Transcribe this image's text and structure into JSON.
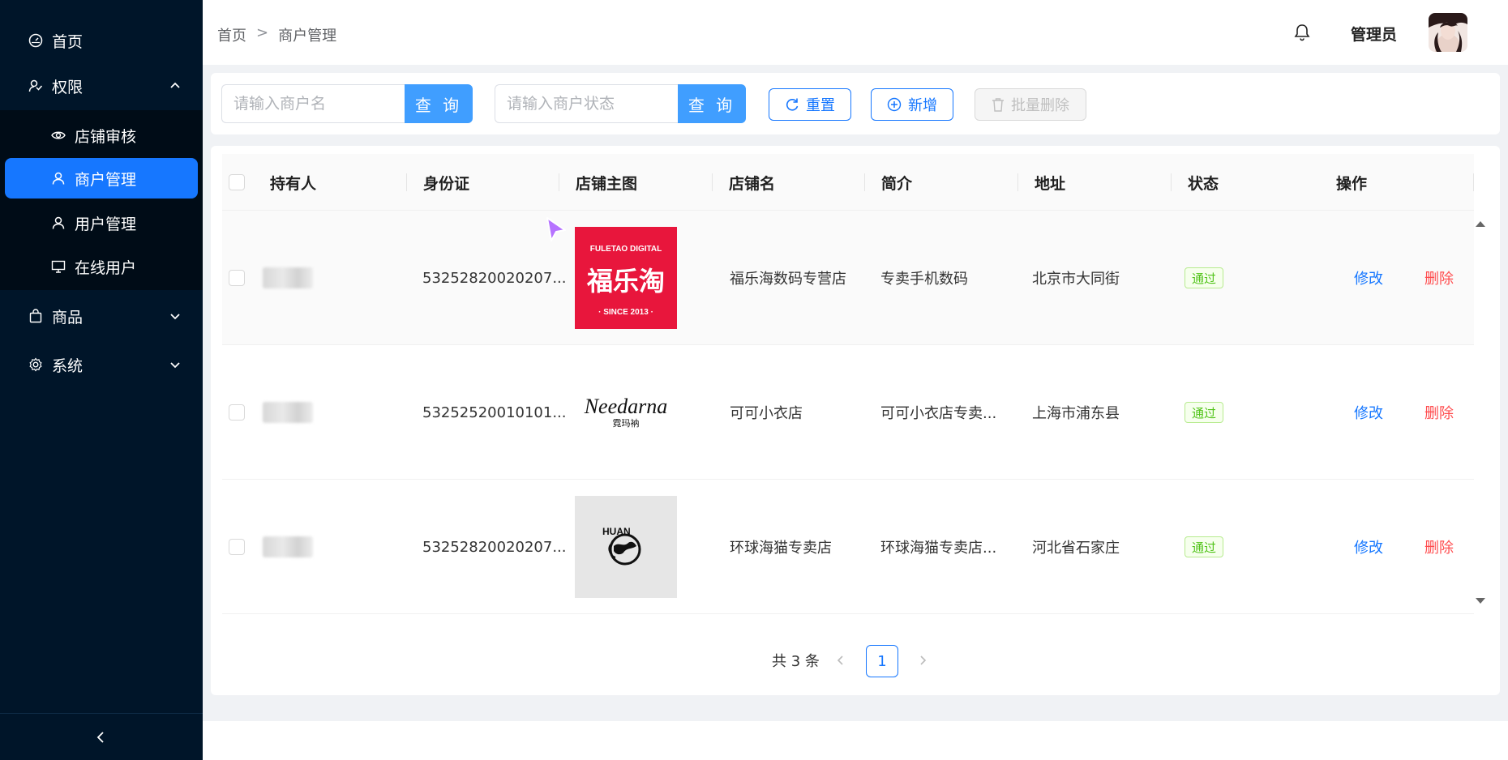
{
  "sidebar": {
    "menu": [
      {
        "label": "首页",
        "icon": "dashboard-icon"
      },
      {
        "label": "权限",
        "icon": "permission-icon"
      },
      {
        "label": "商品",
        "icon": "bag-icon"
      },
      {
        "label": "系统",
        "icon": "settings-icon"
      }
    ],
    "submenu": [
      {
        "label": "店铺审核",
        "icon": "eye-icon"
      },
      {
        "label": "商户管理",
        "icon": "user-icon"
      },
      {
        "label": "用户管理",
        "icon": "user-icon"
      },
      {
        "label": "在线用户",
        "icon": "monitor-icon"
      }
    ],
    "active_item": "商户管理",
    "collapse_icon": "chevron-left-icon"
  },
  "header": {
    "breadcrumb": [
      "首页",
      "商户管理"
    ],
    "breadcrumb_sep": ">",
    "user_name": "管理员",
    "bell_icon": "bell-icon"
  },
  "toolbar": {
    "search_name_placeholder": "请输入商户名",
    "search_status_placeholder": "请输入商户状态",
    "search_btn": "查 询",
    "reset_btn": "重置",
    "add_btn": "新增",
    "batch_delete_btn": "批量删除"
  },
  "table": {
    "columns": [
      "持有人",
      "身份证",
      "店铺主图",
      "店铺名",
      "简介",
      "地址",
      "状态",
      "操作"
    ],
    "rows": [
      {
        "id_card": "53252820020207...",
        "shop_name": "福乐海数码专营店",
        "intro": "专卖手机数码",
        "address": "北京市大同街",
        "status": "通过",
        "logo": {
          "top": "FULETAO DIGITAL",
          "main": "福乐淘",
          "bottom": "· SINCE 2013 ·",
          "bg": "#e8163c"
        }
      },
      {
        "id_card": "53252520010101...",
        "shop_name": "可可小衣店",
        "intro": "可可小衣店专卖...",
        "address": "上海市浦东县",
        "status": "通过",
        "logo": {
          "main": "Needarna",
          "sub": "霓玛衲",
          "bg": "#ffffff"
        }
      },
      {
        "id_card": "53252820020207...",
        "shop_name": "环球海猫专卖店",
        "intro": "环球海猫专卖店...",
        "address": "河北省石家庄",
        "status": "通过",
        "logo": {
          "main": "HUAN",
          "bg": "#e6e6e6"
        }
      }
    ],
    "edit_label": "修改",
    "delete_label": "删除"
  },
  "pagination": {
    "total_text": "共 3 条",
    "current_page": "1"
  },
  "colors": {
    "sidebar_bg": "#001529",
    "submenu_bg": "#000c17",
    "primary": "#1677ff",
    "search_btn": "#409eff",
    "danger": "#ff4d4f",
    "success": "#52c41a"
  }
}
